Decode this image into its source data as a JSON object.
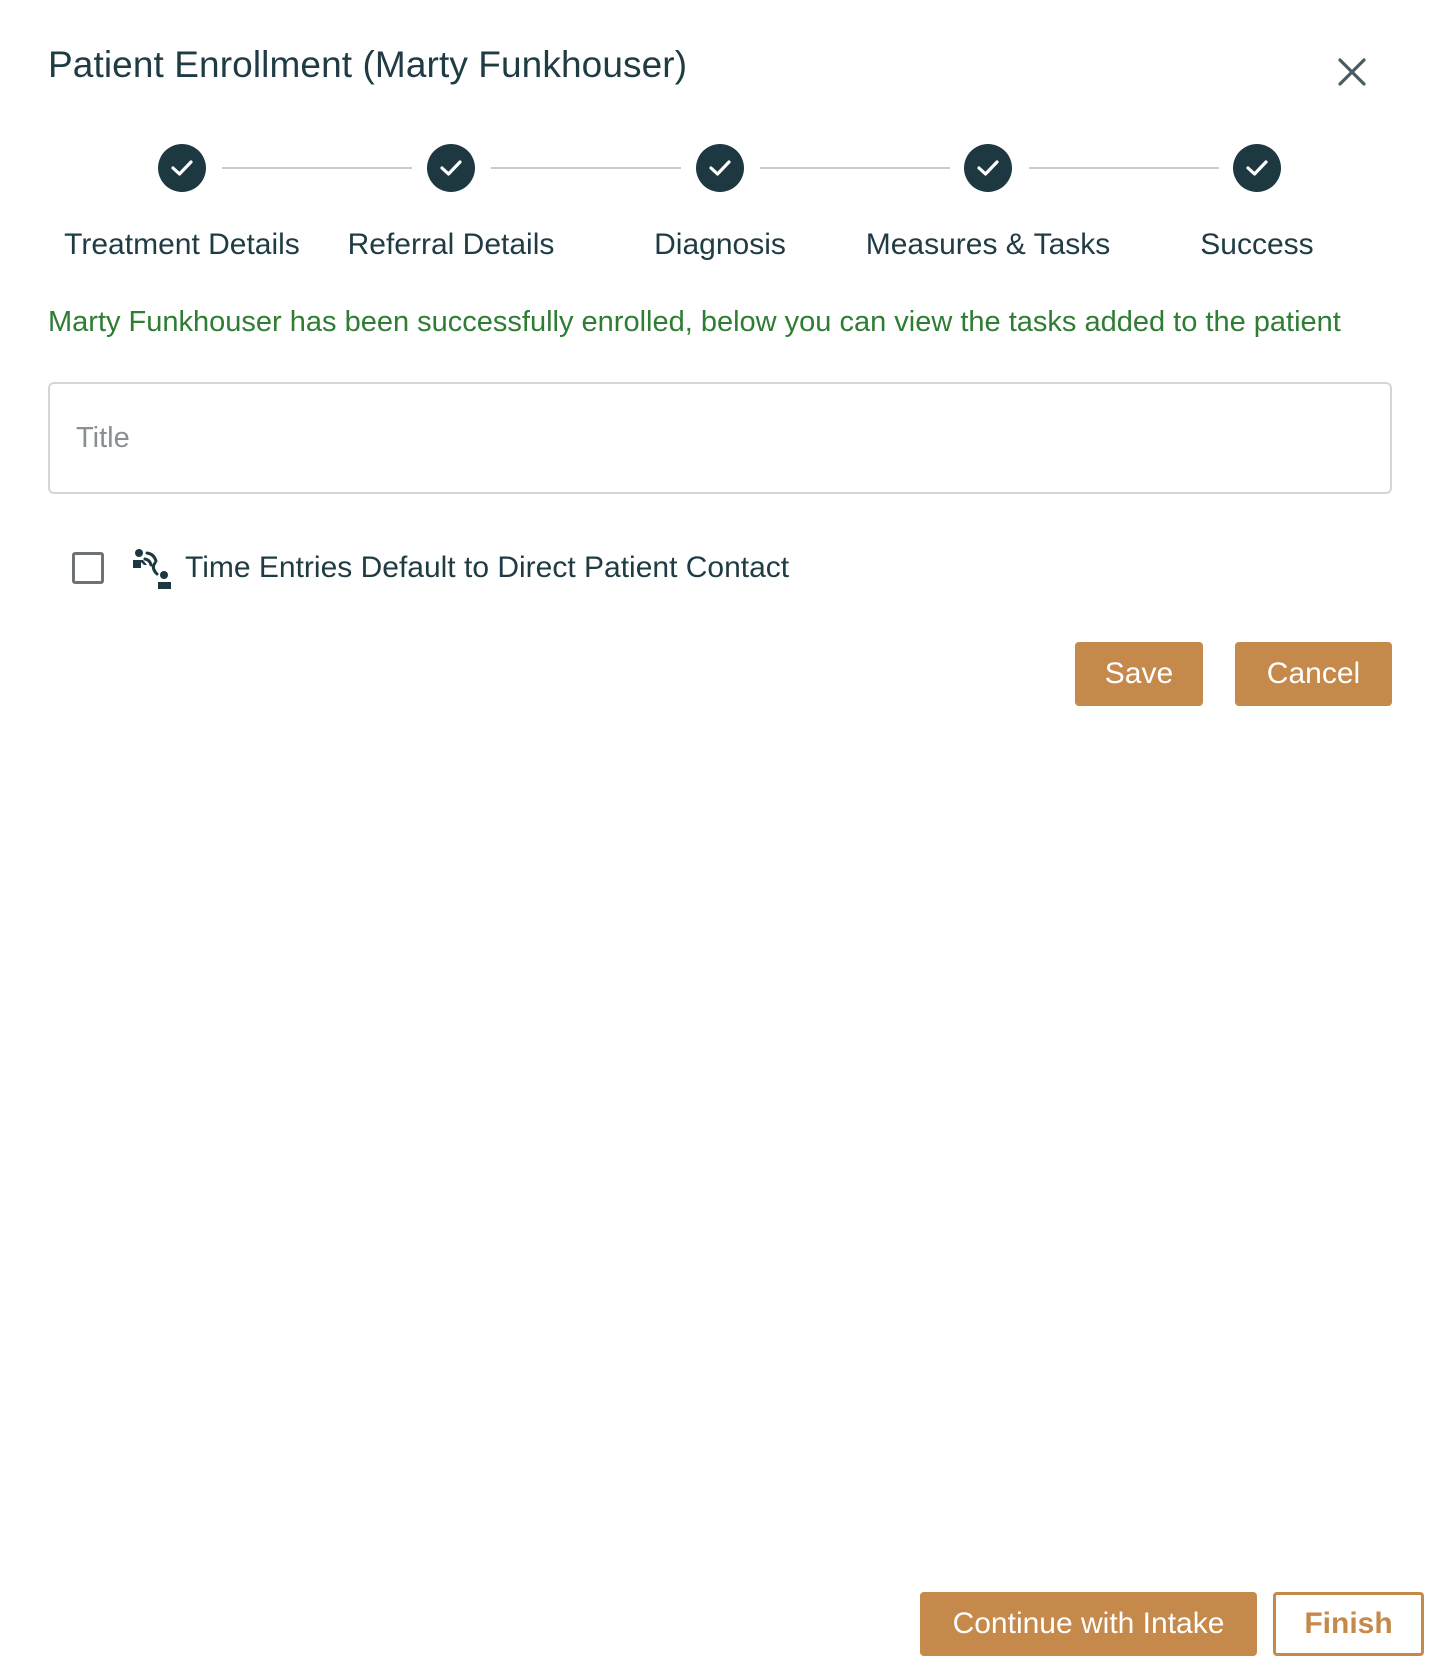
{
  "modal": {
    "title": "Patient Enrollment (Marty Funkhouser)",
    "close_icon": "close-icon"
  },
  "stepper": {
    "steps": [
      {
        "label": "Treatment Details",
        "status": "complete"
      },
      {
        "label": "Referral Details",
        "status": "complete"
      },
      {
        "label": "Diagnosis",
        "status": "complete"
      },
      {
        "label": "Measures & Tasks",
        "status": "complete"
      },
      {
        "label": "Success",
        "status": "complete"
      }
    ],
    "complete_color": "#1d3841"
  },
  "message": {
    "success_text": "Marty Funkhouser has been successfully enrolled, below you can view the tasks added to the patient",
    "color": "#2e7d32"
  },
  "form": {
    "title_placeholder": "Title",
    "title_value": "",
    "direct_contact_checked": false,
    "direct_contact_label": "Time Entries Default to Direct Patient Contact",
    "direct_contact_icon": "direct-patient-contact-icon",
    "save_label": "Save",
    "cancel_label": "Cancel"
  },
  "footer": {
    "continue_label": "Continue with Intake",
    "finish_label": "Finish"
  },
  "colors": {
    "accent": "#c4894b",
    "text": "#1f3b44"
  }
}
